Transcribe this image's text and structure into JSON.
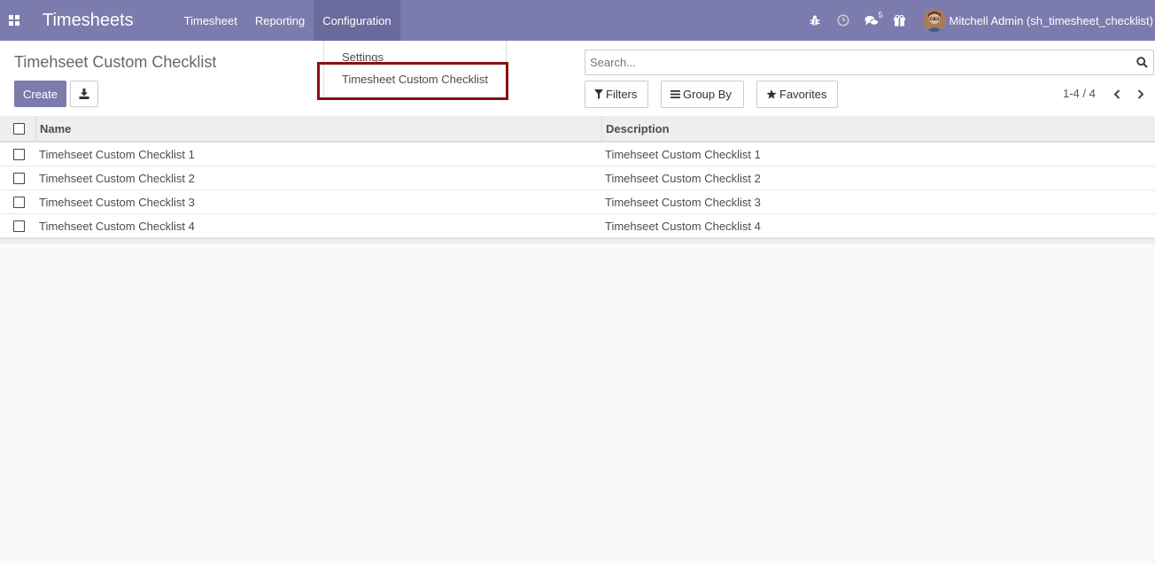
{
  "navbar": {
    "brand": "Timesheets",
    "menu": [
      {
        "label": "Timesheet"
      },
      {
        "label": "Reporting"
      },
      {
        "label": "Configuration"
      }
    ],
    "chat_badge": "5",
    "user_name": "Mitchell Admin (sh_timesheet_checklist)"
  },
  "dropdown": {
    "items": [
      {
        "label": "Settings"
      },
      {
        "label": "Timesheet Custom Checklist"
      }
    ]
  },
  "control_panel": {
    "breadcrumb": "Timehseet Custom Checklist",
    "create_label": "Create",
    "search_placeholder": "Search...",
    "filters_label": "Filters",
    "groupby_label": "Group By",
    "favorites_label": "Favorites",
    "pager": "1-4 / 4"
  },
  "table": {
    "headers": {
      "name": "Name",
      "description": "Description"
    },
    "rows": [
      {
        "name": "Timehseet Custom Checklist 1",
        "description": "Timehseet Custom Checklist 1"
      },
      {
        "name": "Timehseet Custom Checklist 2",
        "description": "Timehseet Custom Checklist 2"
      },
      {
        "name": "Timehseet Custom Checklist 3",
        "description": "Timehseet Custom Checklist 3"
      },
      {
        "name": "Timehseet Custom Checklist 4",
        "description": "Timehseet Custom Checklist 4"
      }
    ]
  },
  "colors": {
    "navbar": "#7c7bad",
    "primary_button": "#7c7bad",
    "highlight_border": "#8b1010"
  }
}
